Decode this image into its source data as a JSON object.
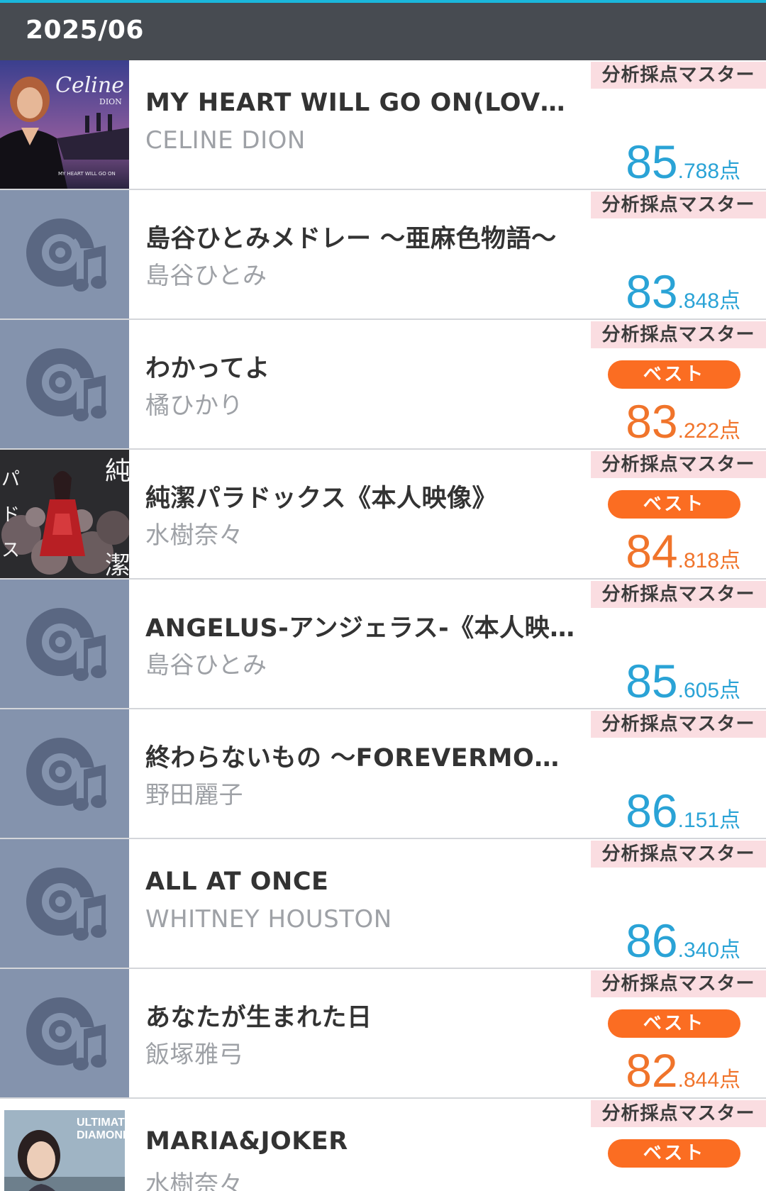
{
  "header": {
    "title": "2025/06"
  },
  "colors": {
    "accent_bar": "#1ab7dc",
    "header_bg": "#474b51",
    "mode_badge_bg": "#fadde1",
    "best_badge_bg": "#fb6d22",
    "score_blue": "#2aa3d6",
    "score_orange": "#f0742b",
    "placeholder_bg": "#8493ad"
  },
  "rows": [
    {
      "title": "MY HEART WILL GO ON(LOVE TH…",
      "artist": "CELINE DION",
      "mode": "分析採点マスター",
      "best": "",
      "score_int": "85",
      "score_dec": ".788点",
      "score_color": "blue",
      "thumb": "album-art-celine-dion"
    },
    {
      "title": "島谷ひとみメドレー ～亜麻色物語～",
      "artist": "島谷ひとみ",
      "mode": "分析採点マスター",
      "best": "",
      "score_int": "83",
      "score_dec": ".848点",
      "score_color": "blue",
      "thumb": "music-disc-icon"
    },
    {
      "title": "わかってよ",
      "artist": "橘ひかり",
      "mode": "分析採点マスター",
      "best": "ベスト",
      "score_int": "83",
      "score_dec": ".222点",
      "score_color": "orange",
      "thumb": "music-disc-icon"
    },
    {
      "title": "純潔パラドックス《本人映像》",
      "artist": "水樹奈々",
      "mode": "分析採点マスター",
      "best": "ベスト",
      "score_int": "84",
      "score_dec": ".818点",
      "score_color": "orange",
      "thumb": "album-art-junketsu-paradox"
    },
    {
      "title": "ANGELUS-アンジェラス-《本人映…",
      "artist": "島谷ひとみ",
      "mode": "分析採点マスター",
      "best": "",
      "score_int": "85",
      "score_dec": ".605点",
      "score_color": "blue",
      "thumb": "music-disc-icon"
    },
    {
      "title": "終わらないもの ～FOREVERMORE～",
      "artist": "野田麗子",
      "mode": "分析採点マスター",
      "best": "",
      "score_int": "86",
      "score_dec": ".151点",
      "score_color": "blue",
      "thumb": "music-disc-icon"
    },
    {
      "title": "ALL AT ONCE",
      "artist": "WHITNEY HOUSTON",
      "mode": "分析採点マスター",
      "best": "",
      "score_int": "86",
      "score_dec": ".340点",
      "score_color": "blue",
      "thumb": "music-disc-icon"
    },
    {
      "title": "あなたが生まれた日",
      "artist": "飯塚雅弓",
      "mode": "分析採点マスター",
      "best": "ベスト",
      "score_int": "82",
      "score_dec": ".844点",
      "score_color": "orange",
      "thumb": "music-disc-icon"
    },
    {
      "title": "MARIA&JOKER",
      "artist": "水樹奈々",
      "mode": "分析採点マスター",
      "best": "ベスト",
      "score_int": "",
      "score_dec": "",
      "score_color": "orange",
      "thumb": "album-art-ultimate-diamond"
    }
  ]
}
